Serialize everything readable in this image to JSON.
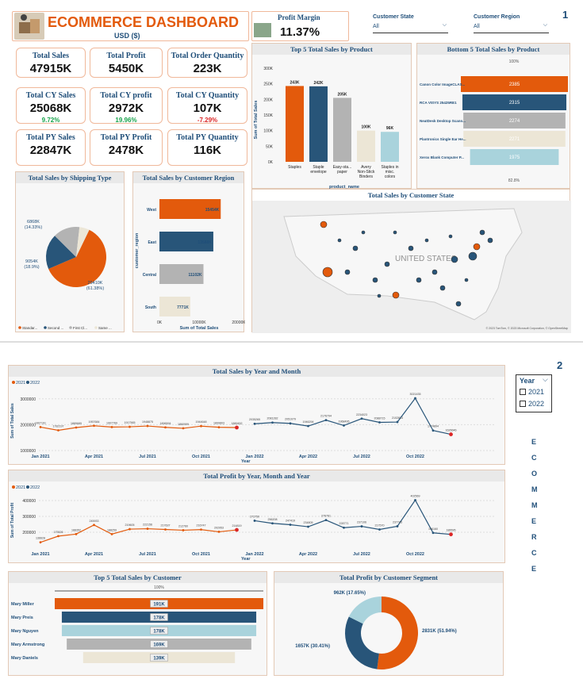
{
  "header": {
    "title": "ECOMMERCE DASHBOARD",
    "currency": "USD ($)",
    "page1": "1",
    "page2": "2"
  },
  "profit_margin": {
    "label": "Profit Margin",
    "value": "11.37%"
  },
  "slicers": {
    "state": {
      "label": "Customer State",
      "value": "All"
    },
    "region": {
      "label": "Customer Region",
      "value": "All"
    }
  },
  "kpis": [
    {
      "label": "Total Sales",
      "value": "47915K"
    },
    {
      "label": "Total Profit",
      "value": "5450K"
    },
    {
      "label": "Total Order Quantity",
      "value": "223K"
    },
    {
      "label": "Total CY Sales",
      "value": "25068K",
      "delta": "9.72%",
      "dcolor": "#16a34a"
    },
    {
      "label": "Total CY profit",
      "value": "2972K",
      "delta": "19.96%",
      "dcolor": "#16a34a"
    },
    {
      "label": "Total CY Quantity",
      "value": "107K",
      "delta": "-7.29%",
      "dcolor": "#dc2626"
    },
    {
      "label": "Total PY Sales",
      "value": "22847K"
    },
    {
      "label": "Total PY Profit",
      "value": "2478K"
    },
    {
      "label": "Total PY Quantity",
      "value": "116K"
    }
  ],
  "year_slicer": {
    "label": "Year",
    "options": [
      "2021",
      "2022"
    ]
  },
  "side_text": [
    "E",
    "C",
    "O",
    "M",
    "M",
    "E",
    "R",
    "C",
    "E"
  ],
  "chart_data": [
    {
      "id": "top5prod",
      "type": "bar",
      "title": "Top 5 Total Sales by Product",
      "xlabel": "product_name",
      "ylabel": "Sum of Total Sales",
      "categories": [
        "Staples",
        "Staple envelope",
        "Easy-sta... paper",
        "Avery Non-Stick Binders",
        "Staples in misc. colors"
      ],
      "values": [
        243,
        242,
        205,
        100,
        96
      ],
      "labels": [
        "243K",
        "242K",
        "205K",
        "100K",
        "96K"
      ],
      "colors": [
        "#e35a0c",
        "#285579",
        "#b3b3b3",
        "#ece6d6",
        "#a9d3dc"
      ],
      "yticks": [
        "0K",
        "50K",
        "100K",
        "150K",
        "200K",
        "250K",
        "300K"
      ],
      "ylim": [
        0,
        300
      ]
    },
    {
      "id": "bottom5",
      "type": "bar",
      "orientation": "horizontal",
      "title": "Bottom 5 Total Sales by Product",
      "categories": [
        "Canon Color ImageCLAS...",
        "RCA VISYS 25425RE1",
        "NeatDesk Desktop Scann...",
        "Plantronics Single Ear He...",
        "Xerox Blank Computer P..."
      ],
      "values": [
        2385,
        2315,
        2274,
        2271,
        1975
      ],
      "colors": [
        "#e35a0c",
        "#285579",
        "#b3b3b3",
        "#ece6d6",
        "#a9d3dc"
      ],
      "top_label": "100%",
      "bottom_label": "82.8%"
    },
    {
      "id": "shipping",
      "type": "pie",
      "title": "Total Sales by Shipping Type",
      "slices": [
        {
          "name": "Standar...",
          "value": 29410,
          "label": "29410K (61.38%)",
          "color": "#e35a0c"
        },
        {
          "name": "Second ...",
          "value": 9054,
          "label": "9054K (18.9%)",
          "color": "#285579"
        },
        {
          "name": "First Cl...",
          "value": 6868,
          "label": "6868K (14.33%)",
          "color": "#b3b3b3"
        },
        {
          "name": "Same ...",
          "value": 2583,
          "label": "",
          "color": "#ece6d6"
        }
      ]
    },
    {
      "id": "region",
      "type": "bar",
      "orientation": "horizontal",
      "title": "Total Sales by Customer Region",
      "ylabel": "customer_region",
      "xlabel": "Sum of Total Sales",
      "categories": [
        "West",
        "East",
        "Central",
        "South"
      ],
      "values": [
        15454,
        13588,
        11102,
        7771
      ],
      "labels": [
        "15454K",
        "13588K",
        "11102K",
        "7771K"
      ],
      "colors": [
        "#e35a0c",
        "#285579",
        "#b3b3b3",
        "#ece6d6"
      ],
      "xticks": [
        "0K",
        "10000K",
        "20000K"
      ],
      "xlim": [
        0,
        20000
      ]
    },
    {
      "id": "salesym",
      "type": "line",
      "title": "Total Sales by Year and Month",
      "xlabel": "Year",
      "ylabel": "Sum of Total Sales",
      "series": [
        {
          "name": "2021",
          "color": "#e35a0c",
          "values": [
            1907191,
            1782197,
            1889689,
            1957684,
            1907769,
            1917565,
            1948875,
            1896594,
            1860999,
            1944648,
            1899803,
            1889452
          ]
        },
        {
          "name": "2022",
          "color": "#285579",
          "values": [
            2035265,
            2081282,
            2051079,
            1946294,
            2176794,
            1968495,
            2234023,
            2088715,
            2102813,
            3021435,
            1774894,
            1626646
          ]
        }
      ],
      "value_labels": {
        "2021": [
          "1907191",
          "1782197",
          "1889689",
          "1957684",
          "1907769",
          "1917565",
          "1948875",
          "1896594",
          "1860999",
          "1944648",
          "1899803",
          "1889452"
        ],
        "2022": [
          "2035265",
          "2081282",
          "2051079",
          "1946294",
          "2176794",
          "1968495",
          "2234023",
          "2088715",
          "2102813",
          "3021435",
          "1774894",
          "1626646"
        ]
      },
      "xticks": [
        "Jan 2021",
        "Apr 2021",
        "Jul 2021",
        "Oct 2021",
        "Jan 2022",
        "Apr 2022",
        "Jul 2022",
        "Oct 2022"
      ],
      "yticks": [
        "1000000",
        "2000000",
        "3000000"
      ],
      "ylim": [
        1000000,
        3300000
      ]
    },
    {
      "id": "profitym",
      "type": "line",
      "title": "Total Profit by Year, Month and Year",
      "xlabel": "Year",
      "ylabel": "Sum of Total Profit",
      "series": [
        {
          "name": "2021",
          "color": "#e35a0c",
          "values": [
            136628,
            175526,
            188352,
            245933,
            188259,
            219605,
            222156,
            217637,
            212760,
            216747,
            202953,
            214819
          ]
        },
        {
          "name": "2022",
          "color": "#285579",
          "values": [
            272750,
            256208,
            247419,
            234805,
            276761,
            228771,
            237106,
            217570,
            237745,
            402569,
            196160,
            186595
          ]
        }
      ],
      "value_labels": {
        "2021": [
          "136628",
          "175526",
          "188352",
          "245933",
          "188259",
          "219605",
          "222156",
          "217637",
          "212760",
          "216747",
          "202953",
          "214819"
        ],
        "2022": [
          "272750",
          "256208",
          "247419",
          "234805",
          "276761",
          "228771",
          "237106",
          "217570",
          "237745",
          "402569",
          "196160",
          "186595"
        ]
      },
      "xticks": [
        "Jan 2021",
        "Apr 2021",
        "Jul 2021",
        "Oct 2021",
        "Jan 2022",
        "Apr 2022",
        "Jul 2022",
        "Oct 2022"
      ],
      "yticks": [
        "200000",
        "300000",
        "400000"
      ],
      "ylim": [
        100000,
        450000
      ]
    },
    {
      "id": "top5cust",
      "type": "bar",
      "orientation": "horizontal",
      "title": "Top 5 Total Sales by Customer",
      "categories": [
        "Mary Miller",
        "Mary Preis",
        "Mary Nguyen",
        "Mary Armstrong",
        "Mary Daniels"
      ],
      "values": [
        191,
        178,
        178,
        169,
        139
      ],
      "labels": [
        "191K",
        "178K",
        "178K",
        "169K",
        "139K"
      ],
      "colors": [
        "#e35a0c",
        "#285579",
        "#a9d3dc",
        "#b3b3b3",
        "#ece6d6"
      ],
      "top_label": "100%"
    },
    {
      "id": "segment",
      "type": "pie",
      "donut": true,
      "title": "Total Profit by Customer Segment",
      "slices": [
        {
          "value": 2831,
          "label": "2831K (51.94%)",
          "color": "#e35a0c"
        },
        {
          "value": 1657,
          "label": "1657K (30.41%)",
          "color": "#285579"
        },
        {
          "value": 962,
          "label": "962K (17.65%)",
          "color": "#a9d3dc"
        }
      ]
    },
    {
      "id": "map",
      "type": "scatter",
      "title": "Total Sales by Customer State",
      "map_label": "UNITED STATES",
      "credit": "© 2023 TomTom, © 2023 Microsoft Corporation, © OpenStreetMap"
    }
  ]
}
